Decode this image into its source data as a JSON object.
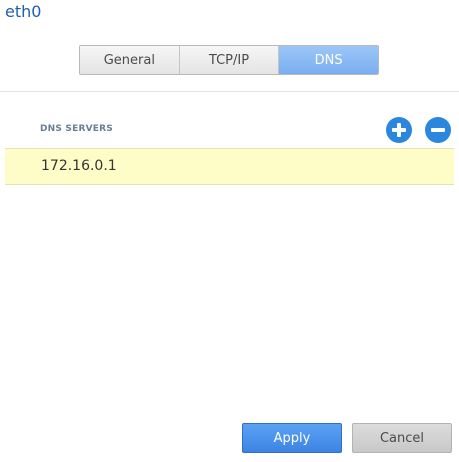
{
  "window": {
    "title": "eth0"
  },
  "tabs": [
    {
      "label": "General",
      "active": false
    },
    {
      "label": "TCP/IP",
      "active": false
    },
    {
      "label": "DNS",
      "active": true
    }
  ],
  "dns": {
    "section_label": "DNS SERVERS",
    "add_icon": "plus-circle-icon",
    "remove_icon": "minus-circle-icon",
    "servers": [
      "172.16.0.1"
    ]
  },
  "footer": {
    "apply_label": "Apply",
    "cancel_label": "Cancel"
  },
  "colors": {
    "accent": "#2b86de",
    "active_tab": "#79aef2",
    "row_highlight": "#fefdc7"
  }
}
